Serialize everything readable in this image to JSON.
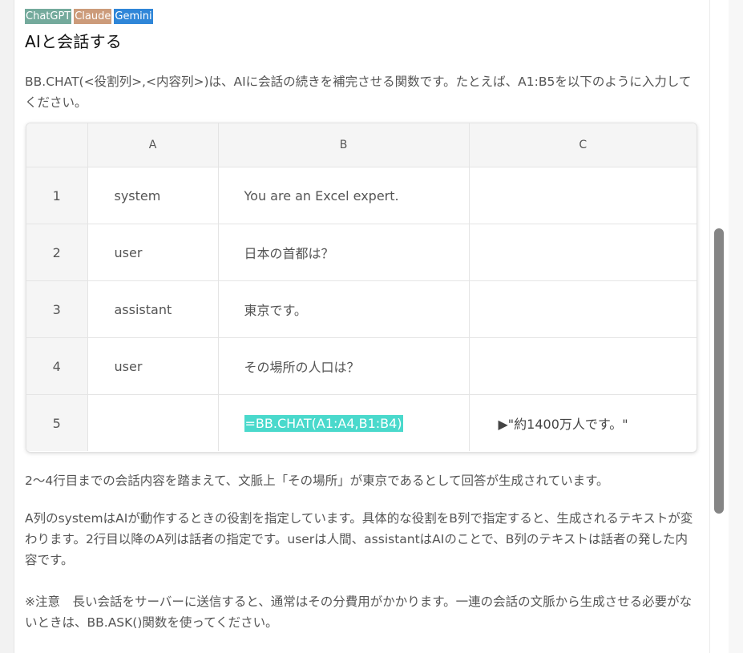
{
  "badges": {
    "chatgpt": "ChatGPT",
    "claude": "Claude",
    "gemini": "Gemini"
  },
  "title": "AIと会話する",
  "intro": "BB.CHAT(<役割列>,<内容列>)は、AIに会話の続きを補完させる関数です。たとえば、A1:B5を以下のように入力してください。",
  "table": {
    "columns": [
      "",
      "A",
      "B",
      "C"
    ],
    "rows": [
      {
        "num": "1",
        "a": "system",
        "b": "You are an Excel expert.",
        "c": ""
      },
      {
        "num": "2",
        "a": "user",
        "b": "日本の首都は？",
        "c": ""
      },
      {
        "num": "3",
        "a": "assistant",
        "b": "東京です。",
        "c": ""
      },
      {
        "num": "4",
        "a": "user",
        "b": "その場所の人口は？",
        "c": ""
      },
      {
        "num": "5",
        "a": "",
        "b": "=BB.CHAT(A1:A4,B1:B4)",
        "c": "▶\"約1400万人です。\""
      }
    ]
  },
  "paragraphs": [
    "2〜4行目までの会話内容を踏まえて、文脈上「その場所」が東京であるとして回答が生成されています。",
    "A列のsystemはAIが動作するときの役割を指定しています。具体的な役割をB列で指定すると、生成されるテキストが変わります。2行目以降のA列は話者の指定です。userは人間、assistantはAIのことで、B列のテキストは話者の発した内容です。",
    "※注意　長い会話をサーバーに送信すると、通常はその分費用がかかります。一連の会話の文脈から生成させる必要がないときは、BB.ASK()関数を使ってください。"
  ],
  "colors": {
    "formula_highlight": "#4ad9cc",
    "badge_chatgpt": "#74aa9c",
    "badge_claude": "#cc9b7a",
    "badge_gemini": "#2f86d8"
  }
}
